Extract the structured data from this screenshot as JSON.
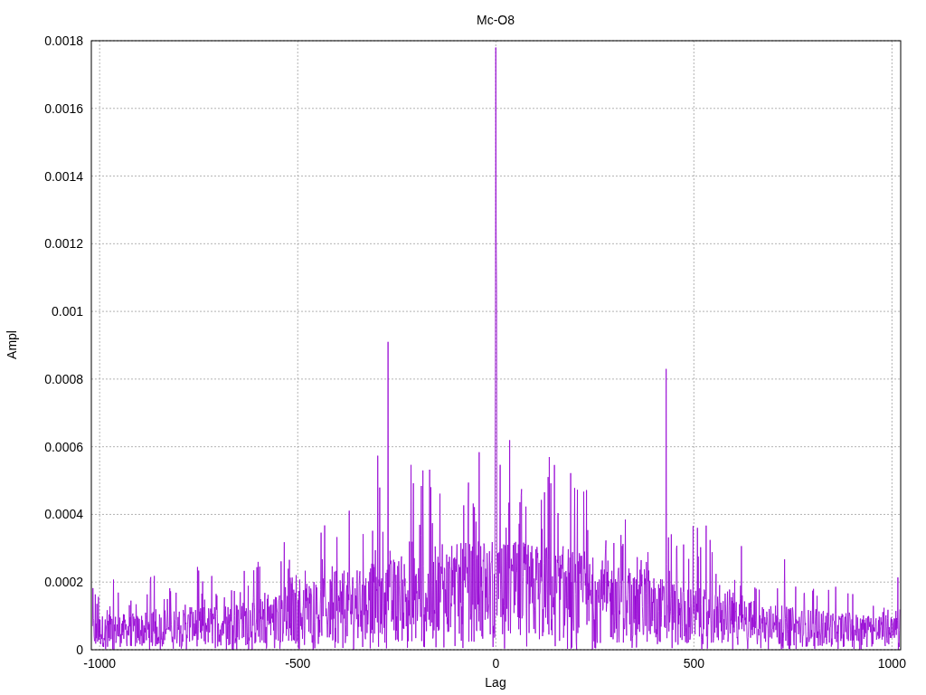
{
  "chart": {
    "title": "Mc-O8",
    "xlabel": "Lag",
    "ylabel": "Ampl",
    "xticks": [
      "-1000",
      "-500",
      "0",
      "500",
      "1000"
    ],
    "yticks": [
      "0.0018",
      "0.0016",
      "0.0014",
      "0.0012",
      "0.001",
      "0.0008",
      "0.0006",
      "0.0004",
      "0.0002",
      "0"
    ]
  }
}
